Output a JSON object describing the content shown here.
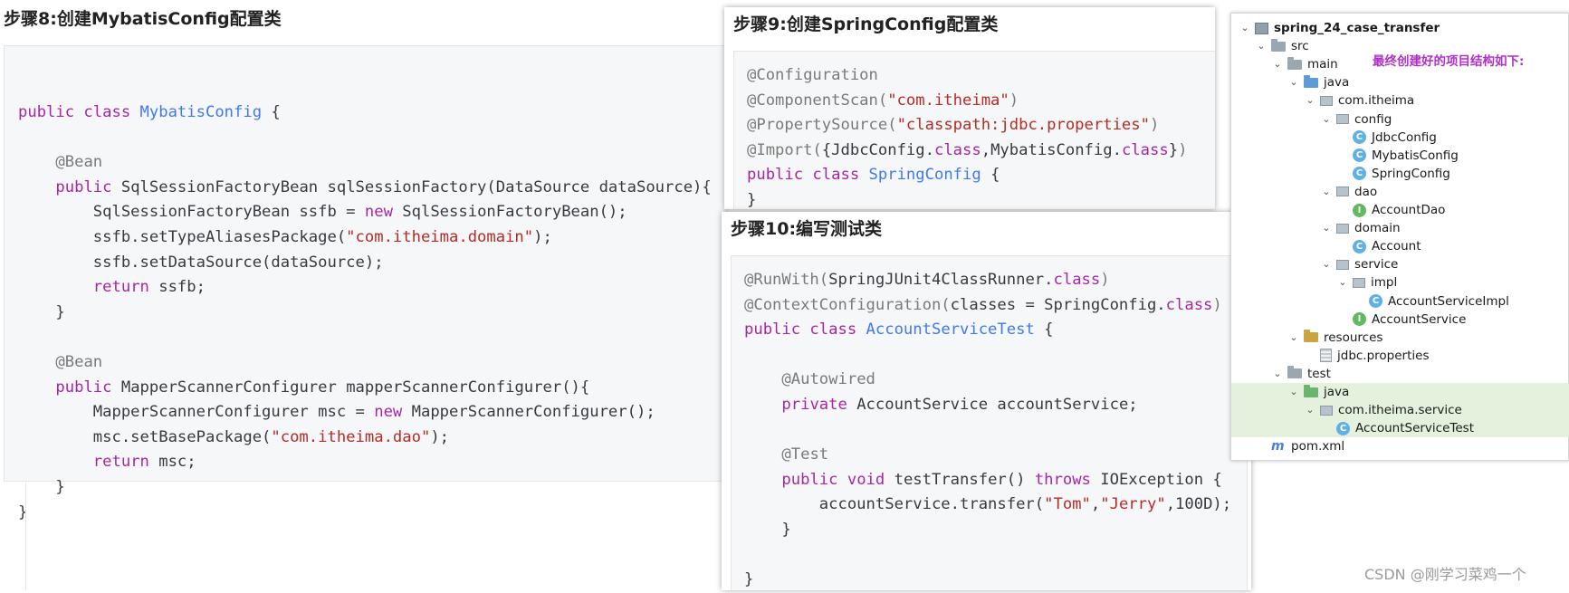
{
  "step8": {
    "heading": "步骤8:创建MybatisConfig配置类",
    "code": [
      [
        [
          "k",
          "public class "
        ],
        [
          "t",
          "MybatisConfig"
        ],
        [
          "p",
          " {"
        ]
      ],
      [],
      [
        [
          "p",
          "    "
        ],
        [
          "a",
          "@Bean"
        ]
      ],
      [
        [
          "p",
          "    "
        ],
        [
          "k",
          "public "
        ],
        [
          "p",
          "SqlSessionFactoryBean sqlSessionFactory(DataSource dataSource){"
        ]
      ],
      [
        [
          "p",
          "        SqlSessionFactoryBean ssfb = "
        ],
        [
          "k",
          "new "
        ],
        [
          "p",
          "SqlSessionFactoryBean();"
        ]
      ],
      [
        [
          "p",
          "        ssfb.setTypeAliasesPackage("
        ],
        [
          "s",
          "\"com.itheima.domain\""
        ],
        [
          "p",
          ");"
        ]
      ],
      [
        [
          "p",
          "        ssfb.setDataSource(dataSource);"
        ]
      ],
      [
        [
          "p",
          "        "
        ],
        [
          "k",
          "return "
        ],
        [
          "p",
          "ssfb;"
        ]
      ],
      [
        [
          "p",
          "    }"
        ]
      ],
      [],
      [
        [
          "p",
          "    "
        ],
        [
          "a",
          "@Bean"
        ]
      ],
      [
        [
          "p",
          "    "
        ],
        [
          "k",
          "public "
        ],
        [
          "p",
          "MapperScannerConfigurer mapperScannerConfigurer(){"
        ]
      ],
      [
        [
          "p",
          "        MapperScannerConfigurer msc = "
        ],
        [
          "k",
          "new "
        ],
        [
          "p",
          "MapperScannerConfigurer();"
        ]
      ],
      [
        [
          "p",
          "        msc.setBasePackage("
        ],
        [
          "s",
          "\"com.itheima.dao\""
        ],
        [
          "p",
          ");"
        ]
      ],
      [
        [
          "p",
          "        "
        ],
        [
          "k",
          "return "
        ],
        [
          "p",
          "msc;"
        ]
      ],
      [
        [
          "p",
          "    }"
        ]
      ],
      [
        [
          "p",
          "}"
        ]
      ]
    ]
  },
  "step9": {
    "heading": "步骤9:创建SpringConfig配置类",
    "code": [
      [
        [
          "a",
          "@Configuration"
        ]
      ],
      [
        [
          "a",
          "@ComponentScan("
        ],
        [
          "s",
          "\"com.itheima\""
        ],
        [
          "a",
          ")"
        ]
      ],
      [
        [
          "a",
          "@PropertySource("
        ],
        [
          "s",
          "\"classpath:jdbc.properties\""
        ],
        [
          "a",
          ")"
        ]
      ],
      [
        [
          "a",
          "@Import("
        ],
        [
          "p",
          "{JdbcConfig."
        ],
        [
          "k",
          "class"
        ],
        [
          "p",
          ",MybatisConfig."
        ],
        [
          "k",
          "class"
        ],
        [
          "p",
          "}"
        ],
        [
          "a",
          ")"
        ]
      ],
      [
        [
          "k",
          "public class "
        ],
        [
          "t",
          "SpringConfig"
        ],
        [
          "p",
          " {"
        ]
      ],
      [
        [
          "p",
          "}"
        ]
      ]
    ]
  },
  "step10": {
    "heading": "步骤10:编写测试类",
    "code": [
      [
        [
          "a",
          "@RunWith("
        ],
        [
          "p",
          "SpringJUnit4ClassRunner."
        ],
        [
          "k",
          "class"
        ],
        [
          "a",
          ")"
        ]
      ],
      [
        [
          "a",
          "@ContextConfiguration("
        ],
        [
          "p",
          "classes = SpringConfig."
        ],
        [
          "k",
          "class"
        ],
        [
          "a",
          ")"
        ]
      ],
      [
        [
          "k",
          "public class "
        ],
        [
          "t",
          "AccountServiceTest"
        ],
        [
          "p",
          " {"
        ]
      ],
      [],
      [
        [
          "p",
          "    "
        ],
        [
          "a",
          "@Autowired"
        ]
      ],
      [
        [
          "p",
          "    "
        ],
        [
          "k",
          "private "
        ],
        [
          "p",
          "AccountService accountService;"
        ]
      ],
      [],
      [
        [
          "p",
          "    "
        ],
        [
          "a",
          "@Test"
        ]
      ],
      [
        [
          "p",
          "    "
        ],
        [
          "k",
          "public void "
        ],
        [
          "p",
          "testTransfer() "
        ],
        [
          "k",
          "throws "
        ],
        [
          "p",
          "IOException {"
        ]
      ],
      [
        [
          "p",
          "        accountService.transfer("
        ],
        [
          "s",
          "\"Tom\""
        ],
        [
          "p",
          ","
        ],
        [
          "s",
          "\"Jerry\""
        ],
        [
          "p",
          ",100D);"
        ]
      ],
      [
        [
          "p",
          "    }"
        ]
      ],
      [],
      [
        [
          "p",
          "}"
        ]
      ]
    ]
  },
  "tree": {
    "note": "最终创建好的项目结构如下:",
    "items": [
      {
        "label": "spring_24_case_transfer",
        "icon": "project-icon",
        "depth": 0,
        "expand": true,
        "bold": true
      },
      {
        "label": "src",
        "icon": "folder-icon",
        "depth": 1,
        "expand": true
      },
      {
        "label": "main",
        "icon": "folder-icon",
        "depth": 2,
        "expand": true
      },
      {
        "label": "java",
        "icon": "source-folder-icon",
        "depth": 3,
        "expand": true
      },
      {
        "label": "com.itheima",
        "icon": "package-icon",
        "depth": 4,
        "expand": true
      },
      {
        "label": "config",
        "icon": "package-icon",
        "depth": 5,
        "expand": true
      },
      {
        "label": "JdbcConfig",
        "icon": "class-icon",
        "depth": 6
      },
      {
        "label": "MybatisConfig",
        "icon": "class-icon",
        "depth": 6
      },
      {
        "label": "SpringConfig",
        "icon": "class-icon",
        "depth": 6
      },
      {
        "label": "dao",
        "icon": "package-icon",
        "depth": 5,
        "expand": true
      },
      {
        "label": "AccountDao",
        "icon": "interface-icon",
        "depth": 6
      },
      {
        "label": "domain",
        "icon": "package-icon",
        "depth": 5,
        "expand": true
      },
      {
        "label": "Account",
        "icon": "class-icon",
        "depth": 6
      },
      {
        "label": "service",
        "icon": "package-icon",
        "depth": 5,
        "expand": true
      },
      {
        "label": "impl",
        "icon": "package-icon",
        "depth": 6,
        "expand": true
      },
      {
        "label": "AccountServiceImpl",
        "icon": "class-icon",
        "depth": 7
      },
      {
        "label": "AccountService",
        "icon": "interface-icon",
        "depth": 6
      },
      {
        "label": "resources",
        "icon": "resources-folder-icon",
        "depth": 3,
        "expand": true
      },
      {
        "label": "jdbc.properties",
        "icon": "properties-file-icon",
        "depth": 4
      },
      {
        "label": "test",
        "icon": "folder-icon",
        "depth": 2,
        "expand": true
      },
      {
        "label": "java",
        "icon": "test-folder-icon",
        "depth": 3,
        "expand": true,
        "selected": true
      },
      {
        "label": "com.itheima.service",
        "icon": "package-icon",
        "depth": 4,
        "expand": true,
        "selected": true
      },
      {
        "label": "AccountServiceTest",
        "icon": "class-icon",
        "depth": 5,
        "selected": true
      },
      {
        "label": "pom.xml",
        "icon": "maven-icon",
        "depth": 1
      }
    ]
  },
  "watermark": "CSDN @刚学习菜鸡一个",
  "colors": {
    "keyword": "#a626a4",
    "type": "#4078f2",
    "string": "#b52b25",
    "annotation": "#7a7a7a",
    "note": "#b030c8"
  }
}
